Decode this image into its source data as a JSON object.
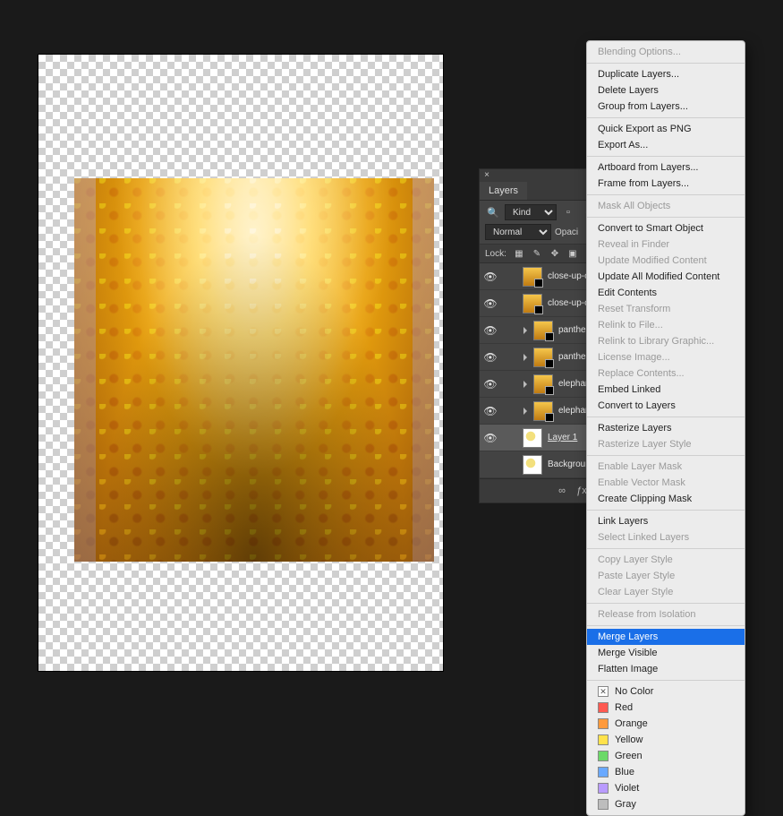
{
  "layers_panel": {
    "tab_label": "Layers",
    "kind_label": "Kind",
    "kind_icons": [
      "image",
      "adjust",
      "type",
      "shape",
      "smart"
    ],
    "blend_mode": "Normal",
    "opacity_label": "Opaci",
    "lock_label": "Lock:",
    "layers": [
      {
        "visible": true,
        "indent": 0,
        "thumb": "tex",
        "smart": true,
        "clip": false,
        "name": "close-up-of-sunglow",
        "selected": false
      },
      {
        "visible": true,
        "indent": 0,
        "thumb": "tex",
        "smart": true,
        "clip": false,
        "name": "close-up-of-sunglow",
        "selected": false
      },
      {
        "visible": true,
        "indent": 1,
        "thumb": "tex",
        "smart": true,
        "clip": true,
        "name": "panther-chamele",
        "selected": false
      },
      {
        "visible": true,
        "indent": 1,
        "thumb": "tex",
        "smart": true,
        "clip": true,
        "name": "panther-chamele",
        "selected": false
      },
      {
        "visible": true,
        "indent": 1,
        "thumb": "tex",
        "smart": true,
        "clip": true,
        "name": "elephant-texture-",
        "selected": false
      },
      {
        "visible": true,
        "indent": 1,
        "thumb": "tex",
        "smart": true,
        "clip": true,
        "name": "elephant-texture-",
        "selected": false
      },
      {
        "visible": true,
        "indent": 0,
        "thumb": "bg",
        "smart": false,
        "clip": false,
        "name": "Layer 1",
        "selected": true,
        "underline": true
      },
      {
        "visible": false,
        "indent": 0,
        "thumb": "bg",
        "smart": false,
        "clip": false,
        "name": "Background",
        "selected": false,
        "locked": true
      }
    ]
  },
  "context_menu": {
    "groups": [
      [
        {
          "label": "Blending Options...",
          "disabled": true
        }
      ],
      [
        {
          "label": "Duplicate Layers..."
        },
        {
          "label": "Delete Layers"
        },
        {
          "label": "Group from Layers..."
        }
      ],
      [
        {
          "label": "Quick Export as PNG"
        },
        {
          "label": "Export As..."
        }
      ],
      [
        {
          "label": "Artboard from Layers..."
        },
        {
          "label": "Frame from Layers..."
        }
      ],
      [
        {
          "label": "Mask All Objects",
          "disabled": true
        }
      ],
      [
        {
          "label": "Convert to Smart Object"
        },
        {
          "label": "Reveal in Finder",
          "disabled": true
        },
        {
          "label": "Update Modified Content",
          "disabled": true
        },
        {
          "label": "Update All Modified Content"
        },
        {
          "label": "Edit Contents"
        },
        {
          "label": "Reset Transform",
          "disabled": true
        },
        {
          "label": "Relink to File...",
          "disabled": true
        },
        {
          "label": "Relink to Library Graphic...",
          "disabled": true
        },
        {
          "label": "License Image...",
          "disabled": true
        },
        {
          "label": "Replace Contents...",
          "disabled": true
        },
        {
          "label": "Embed Linked"
        },
        {
          "label": "Convert to Layers"
        }
      ],
      [
        {
          "label": "Rasterize Layers"
        },
        {
          "label": "Rasterize Layer Style",
          "disabled": true
        }
      ],
      [
        {
          "label": "Enable Layer Mask",
          "disabled": true
        },
        {
          "label": "Enable Vector Mask",
          "disabled": true
        },
        {
          "label": "Create Clipping Mask"
        }
      ],
      [
        {
          "label": "Link Layers"
        },
        {
          "label": "Select Linked Layers",
          "disabled": true
        }
      ],
      [
        {
          "label": "Copy Layer Style",
          "disabled": true
        },
        {
          "label": "Paste Layer Style",
          "disabled": true
        },
        {
          "label": "Clear Layer Style",
          "disabled": true
        }
      ],
      [
        {
          "label": "Release from Isolation",
          "disabled": true
        }
      ],
      [
        {
          "label": "Merge Layers",
          "highlight": true
        },
        {
          "label": "Merge Visible"
        },
        {
          "label": "Flatten Image"
        }
      ]
    ],
    "colors": [
      {
        "label": "No Color",
        "hex": "none"
      },
      {
        "label": "Red",
        "hex": "#ff5a52"
      },
      {
        "label": "Orange",
        "hex": "#ff9a3c"
      },
      {
        "label": "Yellow",
        "hex": "#ffe24b"
      },
      {
        "label": "Green",
        "hex": "#6cd968"
      },
      {
        "label": "Blue",
        "hex": "#6aa9ff"
      },
      {
        "label": "Violet",
        "hex": "#b99bff"
      },
      {
        "label": "Gray",
        "hex": "#bdbdbd"
      }
    ]
  }
}
